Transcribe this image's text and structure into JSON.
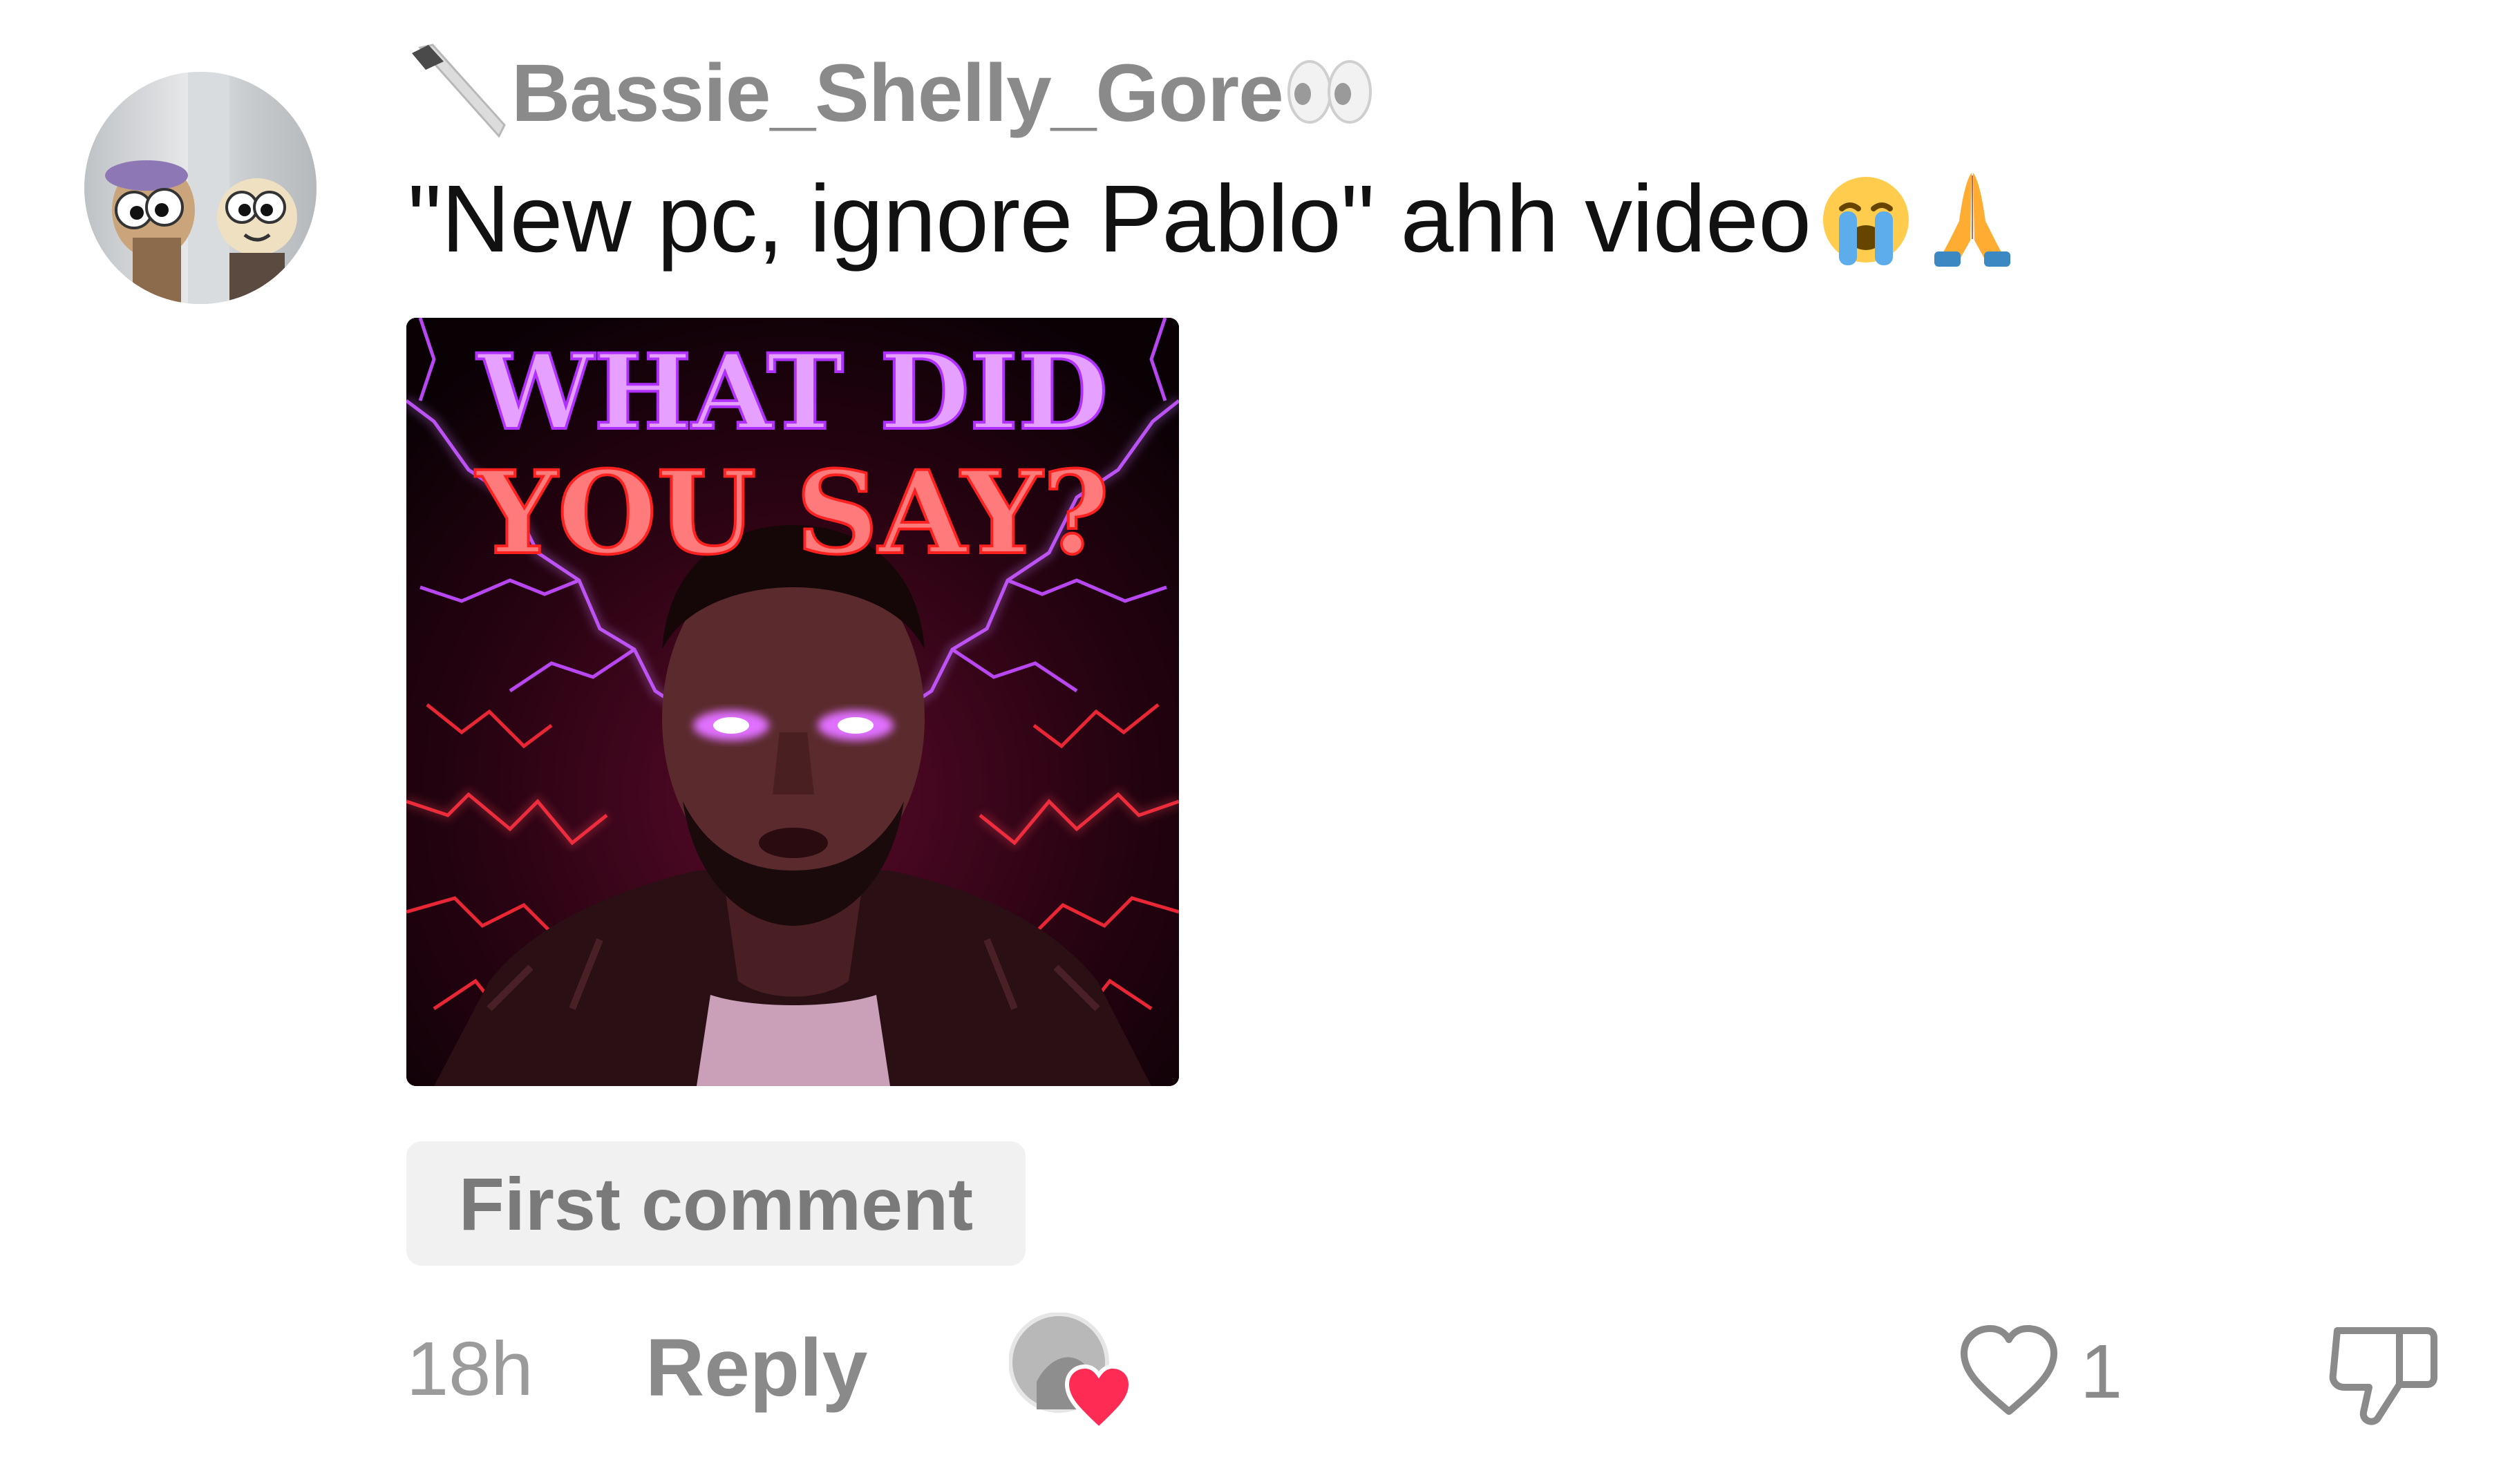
{
  "comment": {
    "username": "Bassie_Shelly_Gore",
    "username_prefix_icon": "knife-icon",
    "username_suffix_icon": "eyes-icon",
    "text": "\"New pc, ignore Pablo\" ahh video",
    "emojis": [
      "loudly-crying-face-icon",
      "folded-hands-icon"
    ],
    "attached_image": {
      "caption_line1": "WHAT DID",
      "caption_line2": "YOU SAY?"
    },
    "badge": "First comment",
    "timestamp": "18h",
    "reply_label": "Reply",
    "like_count": "1",
    "liked_by_creator": true
  },
  "colors": {
    "username": "#8a8a8a",
    "text": "#111111",
    "badge_bg": "#f1f1f1",
    "heart_red": "#fe2c55",
    "muted": "#9b9b9b"
  }
}
